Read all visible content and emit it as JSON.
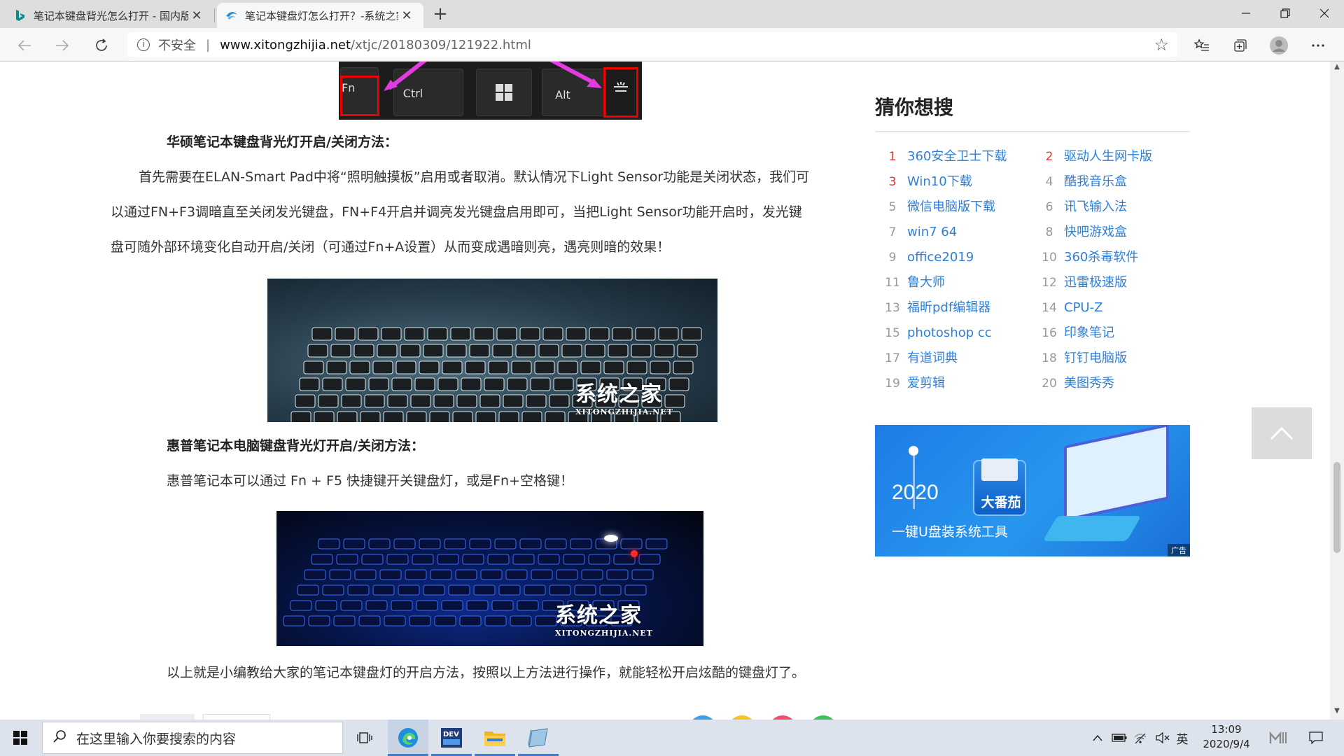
{
  "browser": {
    "tabs": [
      {
        "title": "笔记本键盘背光怎么打开 - 国内版",
        "favicon": "bing-icon",
        "active": false
      },
      {
        "title": "笔记本键盘灯怎么打开？-系统之家",
        "favicon": "site-logo-icon",
        "active": true
      }
    ],
    "new_tab": "+",
    "address": {
      "security_label": "不安全",
      "separator": "|",
      "host": "www.xitongzhijia.net",
      "path": "/xtjc/20180309/121922.html"
    }
  },
  "article": {
    "image1_keys": [
      "Fn",
      "Ctrl",
      "Alt"
    ],
    "heading_asus": "华硕笔记本键盘背光灯开启/关闭方法：",
    "para_asus": "首先需要在ELAN-Smart Pad中将“照明触摸板”启用或者取消。默认情况下Light Sensor功能是关闭状态，我们可以通过FN+F3调暗直至关闭发光键盘，FN+F4开启并调亮发光键盘启用即可，当把Light Sensor功能开启时，发光键盘可随外部环境变化自动开启/关闭（可通过Fn+A设置）从而变成遇暗则亮，遇亮则暗的效果！",
    "heading_hp": "惠普笔记本电脑键盘背光灯开启/关闭方法：",
    "para_hp": "惠普笔记本可以通过 Fn + F5 快捷键开关键盘灯，或是Fn+空格键！",
    "para_end": "以上就是小编教给大家的笔记本键盘灯的开启方法，按照以上方法进行操作，就能轻松开启炫酷的键盘灯了。",
    "watermark_cn": "系统之家",
    "watermark_en": "XITONGZHIJIA.NET"
  },
  "sidebar": {
    "title": "猜你想搜",
    "items": [
      {
        "num": "1",
        "label": "360安全卫士下载"
      },
      {
        "num": "2",
        "label": "驱动人生网卡版"
      },
      {
        "num": "3",
        "label": "Win10下载"
      },
      {
        "num": "4",
        "label": "酷我音乐盒"
      },
      {
        "num": "5",
        "label": "微信电脑版下载"
      },
      {
        "num": "6",
        "label": "讯飞输入法"
      },
      {
        "num": "7",
        "label": "win7 64"
      },
      {
        "num": "8",
        "label": "快吧游戏盒"
      },
      {
        "num": "9",
        "label": "office2019"
      },
      {
        "num": "10",
        "label": "360杀毒软件"
      },
      {
        "num": "11",
        "label": "鲁大师"
      },
      {
        "num": "12",
        "label": "迅雷极速版"
      },
      {
        "num": "13",
        "label": "福昕pdf编辑器"
      },
      {
        "num": "14",
        "label": "CPU-Z"
      },
      {
        "num": "15",
        "label": "photoshop cc"
      },
      {
        "num": "16",
        "label": "印象笔记"
      },
      {
        "num": "17",
        "label": "有道词典"
      },
      {
        "num": "18",
        "label": "钉钉电脑版"
      },
      {
        "num": "19",
        "label": "爱剪辑"
      },
      {
        "num": "20",
        "label": "美图秀秀"
      }
    ],
    "ad": {
      "year": "2020",
      "brand": "大番茄",
      "slogan": "一键U盘装系统工具",
      "tag": "广告"
    }
  },
  "taskbar": {
    "search_placeholder": "在这里输入你要搜索的内容",
    "ime": "英",
    "time": "13:09",
    "date": "2020/9/4"
  },
  "colors": {
    "link": "#2e7fd8",
    "rank_top": "#e63232",
    "ad_bg": "#2896ef"
  }
}
